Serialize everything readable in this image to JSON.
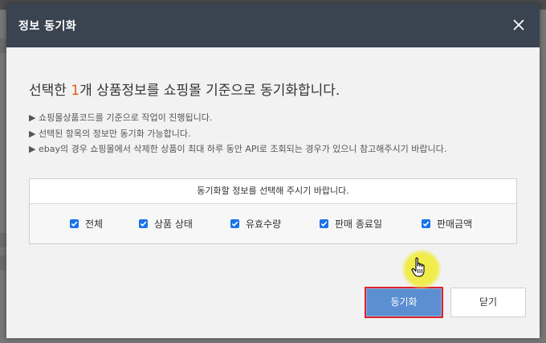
{
  "modal": {
    "title": "정보 동기화",
    "headline_prefix": "선택한 ",
    "headline_count": "1",
    "headline_suffix": "개 상품정보를 쇼핑몰 기준으로 동기화합니다.",
    "notes": [
      "▶ 쇼핑몰상품코드를 기준으로 작업이 진행됩니다.",
      "▶ 선택된 항목의 정보만 동기화 가능합니다.",
      "▶ ebay의 경우 쇼핑몰에서 삭제한 상품이 최대 하루 동안 API로 조회되는 경우가 있으니 참고해주시기 바랍니다."
    ],
    "select_prompt": "동기화할 정보를 선택해 주시기 바랍니다.",
    "options": [
      {
        "label": "전체",
        "checked": true
      },
      {
        "label": "상품 상태",
        "checked": true
      },
      {
        "label": "유효수량",
        "checked": true
      },
      {
        "label": "판매 종료일",
        "checked": true
      },
      {
        "label": "판매금액",
        "checked": true
      }
    ],
    "buttons": {
      "sync": "동기화",
      "close": "닫기"
    }
  },
  "colors": {
    "header_bg": "#3a4350",
    "accent_count": "#e05c17",
    "sync_button": "#5b8fd2",
    "sync_button_border": "#e0202a",
    "checkbox": "#1a73e8",
    "cursor_highlight": "#f0ec3c"
  },
  "icons": {
    "close": "close-icon",
    "checkbox": "checkbox-checked-icon",
    "cursor": "hand-pointer-icon"
  }
}
